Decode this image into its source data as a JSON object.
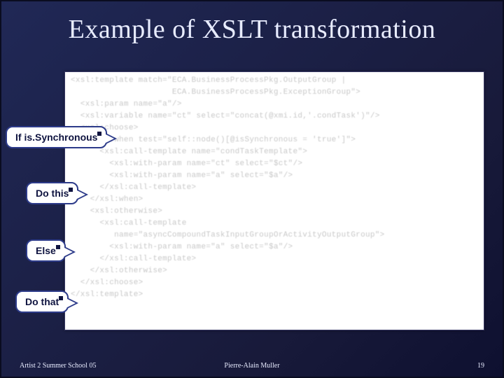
{
  "title": "Example of XSLT transformation",
  "code_lines": [
    "<xsl:template match=\"ECA.BusinessProcessPkg.OutputGroup |",
    "                     ECA.BusinessProcessPkg.ExceptionGroup\">",
    "  <xsl:param name=\"a\"/>",
    "  <xsl:variable name=\"ct\" select=\"concat(@xmi.id,'.condTask')\"/>",
    "  <xsl:choose>",
    "    <xsl:when test=\"self::node()[@isSynchronous = 'true']\">",
    "      <xsl:call-template name=\"condTaskTemplate\">",
    "        <xsl:with-param name=\"ct\" select=\"$ct\"/>",
    "        <xsl:with-param name=\"a\" select=\"$a\"/>",
    "      </xsl:call-template>",
    "    </xsl:when>",
    "    <xsl:otherwise>",
    "      <xsl:call-template",
    "         name=\"asyncCompoundTaskInputGroupOrActivityOutputGroup\">",
    "        <xsl:with-param name=\"a\" select=\"$a\"/>",
    "      </xsl:call-template>",
    "    </xsl:otherwise>",
    "  </xsl:choose>",
    "</xsl:template>"
  ],
  "callouts": [
    {
      "label": "If is.Synchronous"
    },
    {
      "label": "Do this"
    },
    {
      "label": "Else"
    },
    {
      "label": "Do that"
    }
  ],
  "footer": {
    "left": "Artist 2 Summer School 05",
    "center": "Pierre-Alain Muller",
    "right": "19"
  }
}
